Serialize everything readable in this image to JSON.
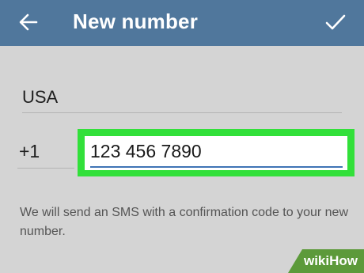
{
  "app_bar": {
    "back_icon": "arrow-left-icon",
    "title": "New number",
    "done_icon": "checkmark-icon",
    "background_color": "#50779c"
  },
  "form": {
    "country": "USA",
    "country_code": "+1",
    "phone_number": "123 456 7890",
    "highlight_color": "#32e03a",
    "active_underline_color": "#3f74b5"
  },
  "info_text": "We will send an SMS with a confirmation code to your new number.",
  "watermark": "wikiHow"
}
